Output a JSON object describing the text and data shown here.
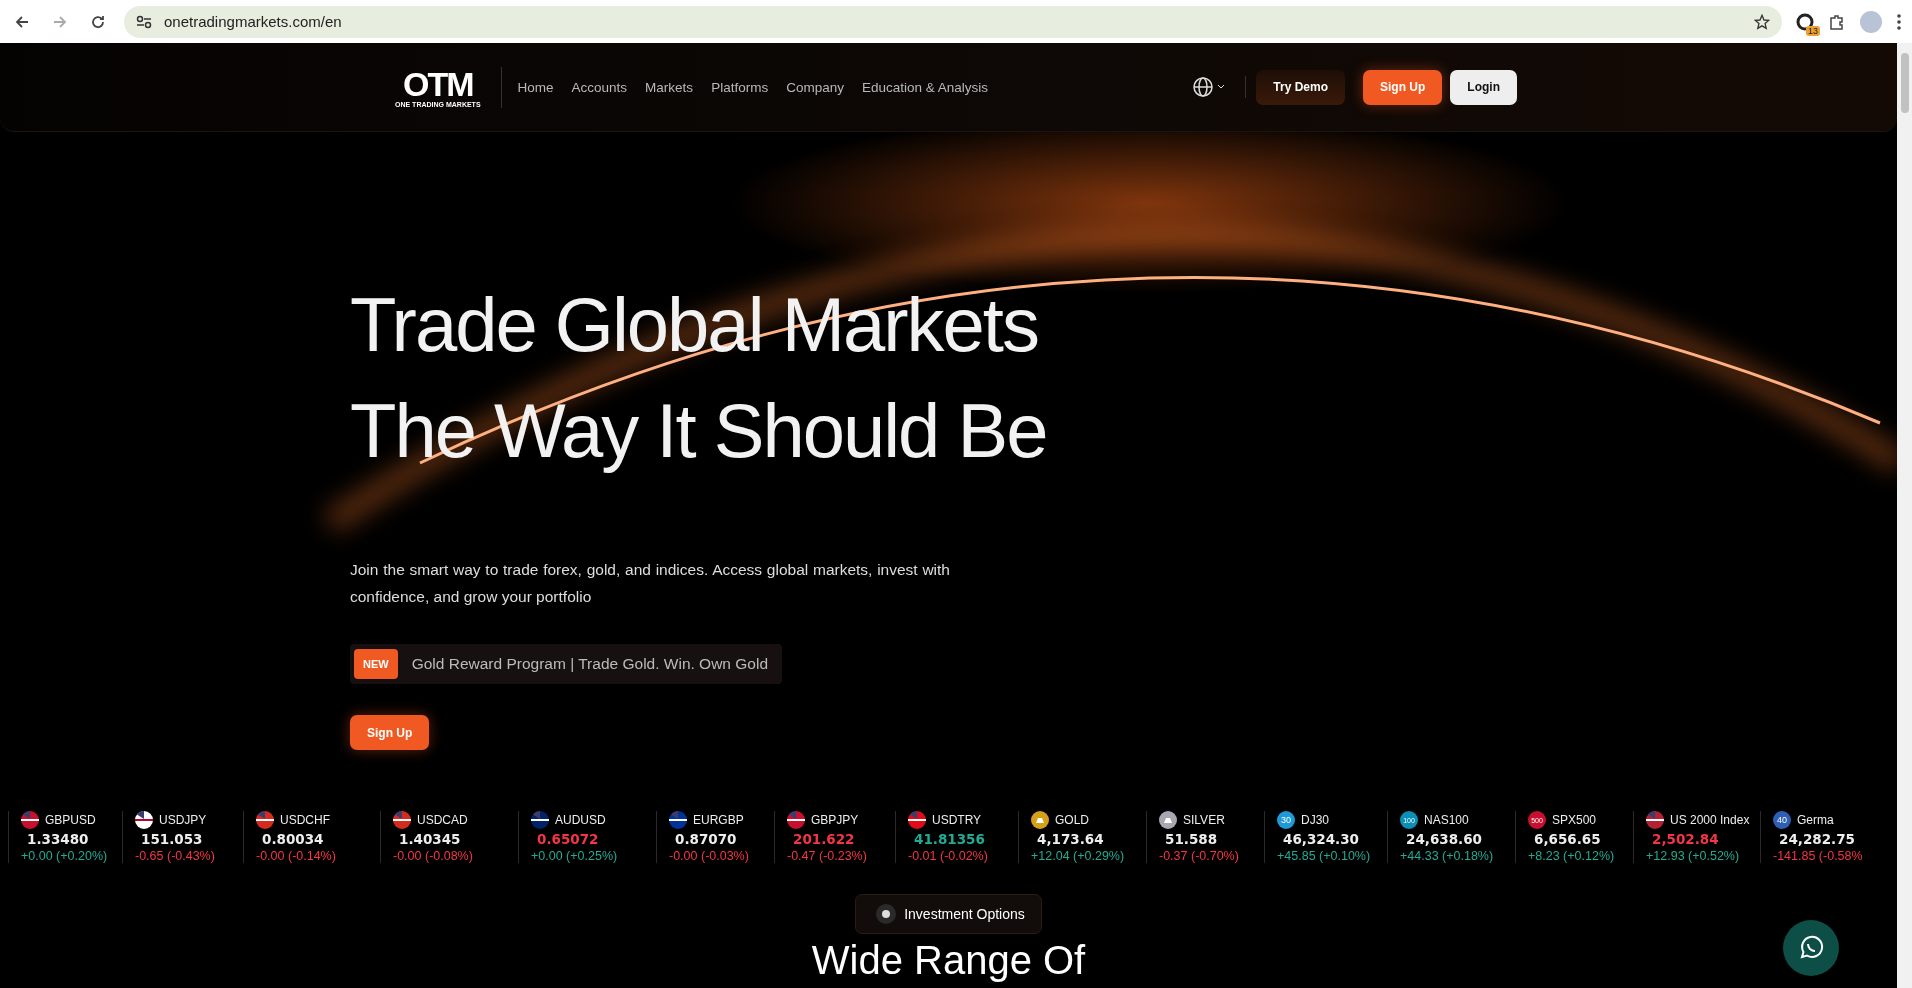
{
  "browser": {
    "url": "onetradingmarkets.com/en",
    "extension_badge": "13"
  },
  "nav": {
    "logo": "OTM",
    "logo_sub": "ONE TRADING MARKETS",
    "links": [
      "Home",
      "Accounts",
      "Markets",
      "Platforms",
      "Company",
      "Education & Analysis"
    ],
    "try_demo": "Try Demo",
    "sign_up": "Sign Up",
    "login": "Login"
  },
  "hero": {
    "title_lines": [
      "Trade Global Markets",
      "The Way It Should Be"
    ],
    "description": "Join the smart way to trade forex, gold, and indices. Access global markets, invest with confidence, and grow your portfolio",
    "promo": {
      "badge": "NEW",
      "text": "Gold Reward Program | Trade Gold. Win. Own Gold"
    },
    "cta": "Sign Up"
  },
  "ticker": [
    {
      "symbol": "GBPUSD",
      "icon": {
        "kind": "flag",
        "color": "#c8102e"
      },
      "price": {
        "text": "1.33480",
        "color": "#eeeeee"
      },
      "change": {
        "text": "+0.00 (+0.20%)",
        "color": "#22ab94"
      }
    },
    {
      "symbol": "USDJPY",
      "icon": {
        "kind": "flag",
        "color": "#ffffff"
      },
      "price": {
        "text": "151.053",
        "color": "#eeeeee"
      },
      "change": {
        "text": "-0.65 (-0.43%)",
        "color": "#f23645"
      }
    },
    {
      "symbol": "USDCHF",
      "icon": {
        "kind": "flag",
        "color": "#d52b1e"
      },
      "price": {
        "text": "0.80034",
        "color": "#eeeeee"
      },
      "change": {
        "text": "-0.00 (-0.14%)",
        "color": "#f23645"
      }
    },
    {
      "symbol": "USDCAD",
      "icon": {
        "kind": "flag",
        "color": "#d52b1e"
      },
      "price": {
        "text": "1.40345",
        "color": "#eeeeee"
      },
      "change": {
        "text": "-0.00 (-0.08%)",
        "color": "#f23645"
      }
    },
    {
      "symbol": "AUDUSD",
      "icon": {
        "kind": "flag",
        "color": "#012169"
      },
      "price": {
        "text": "0.65072",
        "color": "#f23645"
      },
      "change": {
        "text": "+0.00 (+0.25%)",
        "color": "#22ab94"
      }
    },
    {
      "symbol": "EURGBP",
      "icon": {
        "kind": "flag",
        "color": "#003399"
      },
      "price": {
        "text": "0.87070",
        "color": "#eeeeee"
      },
      "change": {
        "text": "-0.00 (-0.03%)",
        "color": "#f23645"
      }
    },
    {
      "symbol": "GBPJPY",
      "icon": {
        "kind": "flag",
        "color": "#c8102e"
      },
      "price": {
        "text": "201.622",
        "color": "#f23645"
      },
      "change": {
        "text": "-0.47 (-0.23%)",
        "color": "#f23645"
      }
    },
    {
      "symbol": "USDTRY",
      "icon": {
        "kind": "flag",
        "color": "#e30a17"
      },
      "price": {
        "text": "41.81356",
        "color": "#22ab94"
      },
      "change": {
        "text": "-0.01 (-0.02%)",
        "color": "#f23645"
      }
    },
    {
      "symbol": "GOLD",
      "icon": {
        "kind": "metal",
        "color": "#d4a017"
      },
      "price": {
        "text": "4,173.64",
        "color": "#eeeeee"
      },
      "change": {
        "text": "+12.04 (+0.29%)",
        "color": "#22ab94"
      }
    },
    {
      "symbol": "SILVER",
      "icon": {
        "kind": "metal",
        "color": "#a8a8b3"
      },
      "price": {
        "text": "51.588",
        "color": "#eeeeee"
      },
      "change": {
        "text": "-0.37 (-0.70%)",
        "color": "#f23645"
      }
    },
    {
      "symbol": "DJ30",
      "icon": {
        "kind": "index",
        "color": "#1e9ad6",
        "label": "30"
      },
      "price": {
        "text": "46,324.30",
        "color": "#eeeeee"
      },
      "change": {
        "text": "+45.85 (+0.10%)",
        "color": "#22ab94"
      }
    },
    {
      "symbol": "NAS100",
      "icon": {
        "kind": "index",
        "color": "#0b8fb5",
        "label": "100"
      },
      "price": {
        "text": "24,638.60",
        "color": "#eeeeee"
      },
      "change": {
        "text": "+44.33 (+0.18%)",
        "color": "#22ab94"
      }
    },
    {
      "symbol": "SPX500",
      "icon": {
        "kind": "index",
        "color": "#c8102e",
        "label": "500"
      },
      "price": {
        "text": "6,656.65",
        "color": "#eeeeee"
      },
      "change": {
        "text": "+8.23 (+0.12%)",
        "color": "#22ab94"
      }
    },
    {
      "symbol": "US 2000 Index",
      "icon": {
        "kind": "flag",
        "color": "#b22234"
      },
      "price": {
        "text": "2,502.84",
        "color": "#f23645"
      },
      "change": {
        "text": "+12.93 (+0.52%)",
        "color": "#22ab94"
      }
    },
    {
      "symbol": "Germa",
      "icon": {
        "kind": "index",
        "color": "#2f5fb3",
        "label": "40"
      },
      "price": {
        "text": "24,282.75",
        "color": "#eeeeee"
      },
      "change": {
        "text": "-141.85 (-0.58%",
        "color": "#f23645"
      }
    }
  ],
  "section": {
    "tag": "Investment Options",
    "heading": "Wide Range Of"
  }
}
